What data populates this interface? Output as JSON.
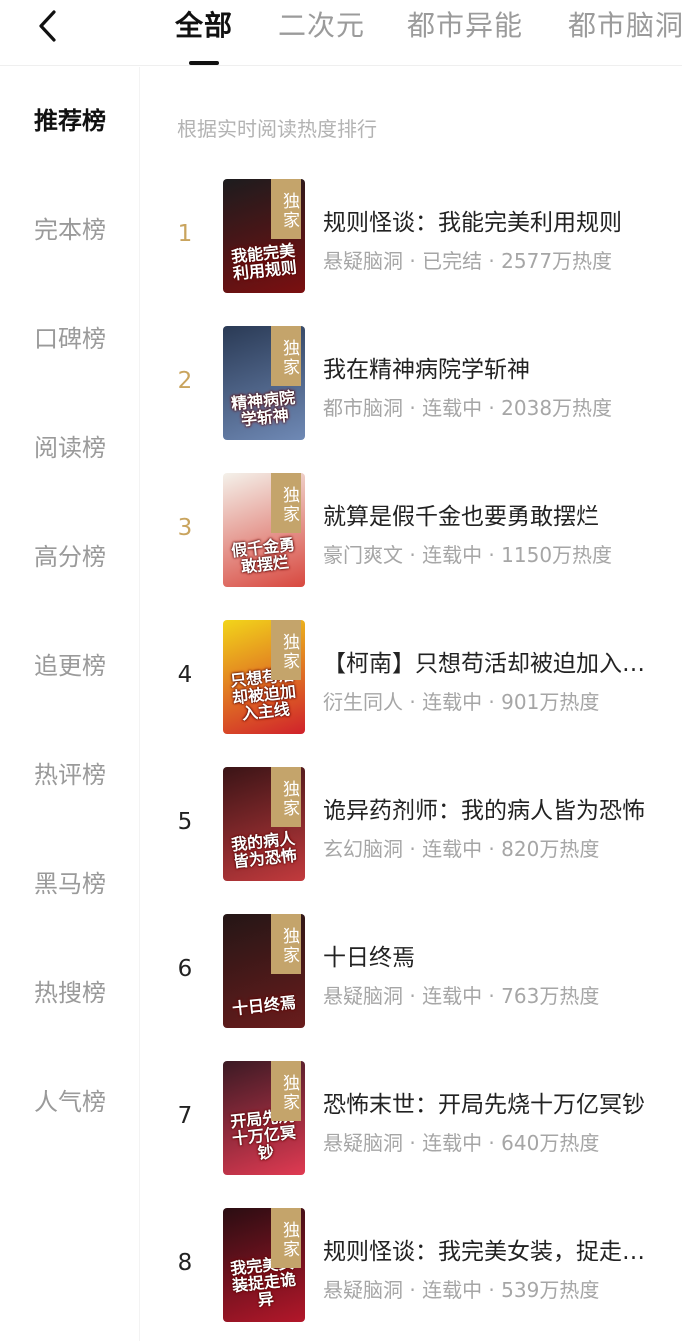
{
  "header": {
    "tabs": [
      {
        "label": "全部",
        "active": true
      },
      {
        "label": "二次元",
        "active": false
      },
      {
        "label": "都市异能",
        "active": false
      },
      {
        "label": "都市脑洞",
        "active": false
      }
    ]
  },
  "sidebar": {
    "items": [
      {
        "label": "推荐榜",
        "active": true
      },
      {
        "label": "完本榜",
        "active": false
      },
      {
        "label": "口碑榜",
        "active": false
      },
      {
        "label": "阅读榜",
        "active": false
      },
      {
        "label": "高分榜",
        "active": false
      },
      {
        "label": "追更榜",
        "active": false
      },
      {
        "label": "热评榜",
        "active": false
      },
      {
        "label": "黑马榜",
        "active": false
      },
      {
        "label": "热搜榜",
        "active": false
      },
      {
        "label": "人气榜",
        "active": false
      }
    ]
  },
  "main": {
    "subtitle": "根据实时阅读热度排行",
    "badge": "独家",
    "books": [
      {
        "rank": "1",
        "title": "规则怪谈：我能完美利用规则",
        "meta": "悬疑脑洞 · 已完结 · 2577万热度",
        "cover_text": "我能完美利用规则",
        "cover_bg": "#1c1c1e",
        "cover_accent": "#7b0f10"
      },
      {
        "rank": "2",
        "title": "我在精神病院学斩神",
        "meta": "都市脑洞 · 连载中 · 2038万热度",
        "cover_text": "精神病院学斩神",
        "cover_bg": "#2a3a55",
        "cover_accent": "#6f89b5"
      },
      {
        "rank": "3",
        "title": "就算是假千金也要勇敢摆烂",
        "meta": "豪门爽文 · 连载中 · 1150万热度",
        "cover_text": "假千金勇敢摆烂",
        "cover_bg": "#f4f1ea",
        "cover_accent": "#d8483f"
      },
      {
        "rank": "4",
        "title": "【柯南】只想苟活却被迫加入主线",
        "meta": "衍生同人 · 连载中 · 901万热度",
        "cover_text": "只想苟活却被迫加入主线",
        "cover_bg": "#f2d51a",
        "cover_accent": "#d0212b"
      },
      {
        "rank": "5",
        "title": "诡异药剂师：我的病人皆为恐怖",
        "meta": "玄幻脑洞 · 连载中 · 820万热度",
        "cover_text": "我的病人皆为恐怖",
        "cover_bg": "#3a1416",
        "cover_accent": "#c23a3d"
      },
      {
        "rank": "6",
        "title": "十日终焉",
        "meta": "悬疑脑洞 · 连载中 · 763万热度",
        "cover_text": "十日终焉",
        "cover_bg": "#241616",
        "cover_accent": "#6a1c1c"
      },
      {
        "rank": "7",
        "title": "恐怖末世：开局先烧十万亿冥钞",
        "meta": "悬疑脑洞 · 连载中 · 640万热度",
        "cover_text": "开局先烧十万亿冥钞",
        "cover_bg": "#3b1a24",
        "cover_accent": "#e03a52"
      },
      {
        "rank": "8",
        "title": "规则怪谈：我完美女装，捉走诡异",
        "meta": "悬疑脑洞 · 连载中 · 539万热度",
        "cover_text": "我完美女装捉走诡异",
        "cover_bg": "#2a0d12",
        "cover_accent": "#b3172a"
      }
    ]
  }
}
